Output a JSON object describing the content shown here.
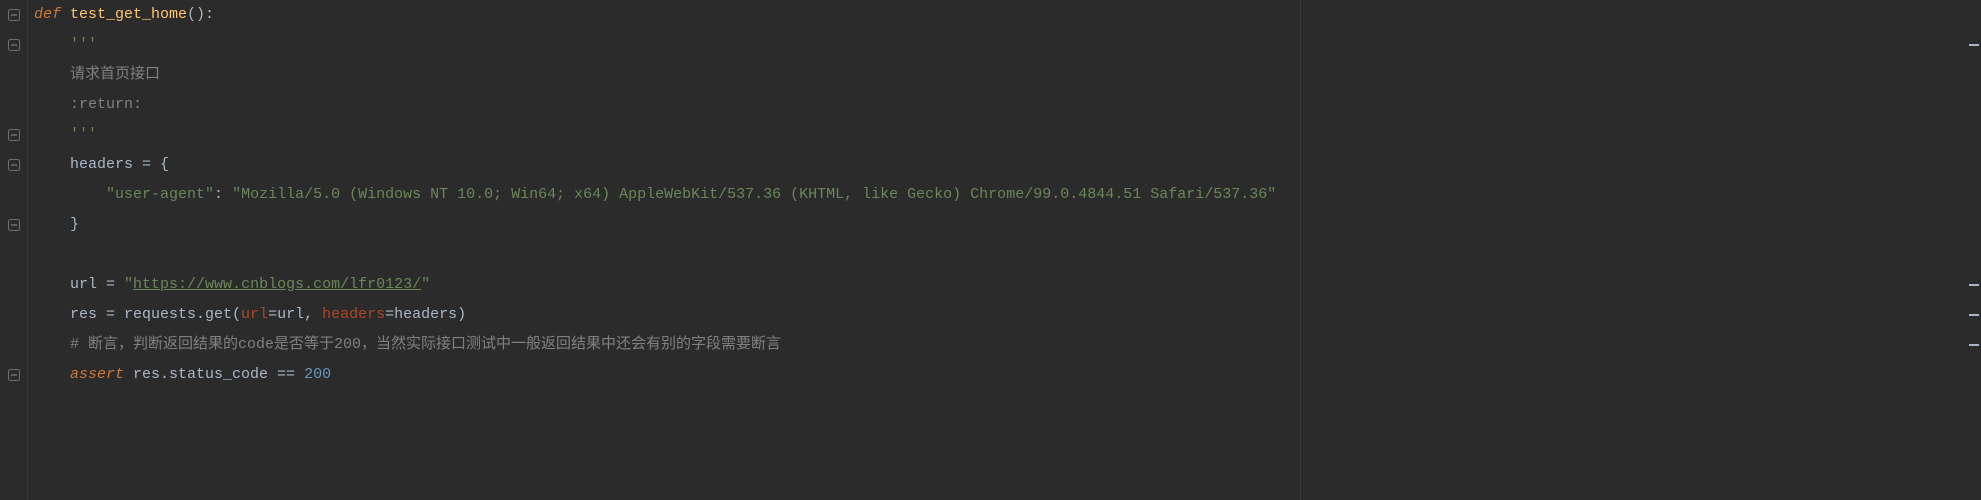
{
  "code": {
    "lines": [
      {
        "indent": 0,
        "tokens": [
          {
            "t": "def ",
            "c": "kw"
          },
          {
            "t": "test_get_home",
            "c": "fn"
          },
          {
            "t": "():",
            "c": "op"
          }
        ]
      },
      {
        "indent": 1,
        "tokens": [
          {
            "t": "'''",
            "c": "str"
          }
        ]
      },
      {
        "indent": 1,
        "tokens": [
          {
            "t": "请求首页接口",
            "c": "comment"
          }
        ]
      },
      {
        "indent": 1,
        "tokens": [
          {
            "t": ":return:",
            "c": "comment"
          }
        ]
      },
      {
        "indent": 1,
        "tokens": [
          {
            "t": "'''",
            "c": "str"
          }
        ]
      },
      {
        "indent": 1,
        "tokens": [
          {
            "t": "headers = {",
            "c": "ident"
          }
        ]
      },
      {
        "indent": 2,
        "tokens": [
          {
            "t": "\"user-agent\"",
            "c": "str"
          },
          {
            "t": ": ",
            "c": "op"
          },
          {
            "t": "\"Mozilla/5.0 (Windows NT 10.0; Win64; x64) AppleWebKit/537.36 (KHTML, like Gecko) Chrome/99.0.4844.51 Safari/537.36\"",
            "c": "str"
          }
        ]
      },
      {
        "indent": 1,
        "tokens": [
          {
            "t": "}",
            "c": "ident"
          }
        ]
      },
      {
        "indent": 0,
        "tokens": [
          {
            "t": "",
            "c": "ident"
          }
        ]
      },
      {
        "indent": 1,
        "tokens": [
          {
            "t": "url = ",
            "c": "ident"
          },
          {
            "t": "\"",
            "c": "str"
          },
          {
            "t": "https://www.cnblogs.com/lfr0123/",
            "c": "str underline"
          },
          {
            "t": "\"",
            "c": "str"
          }
        ]
      },
      {
        "indent": 1,
        "tokens": [
          {
            "t": "res = requests.get(",
            "c": "ident"
          },
          {
            "t": "url",
            "c": "param"
          },
          {
            "t": "=url",
            "c": "ident"
          },
          {
            "t": ", ",
            "c": "op"
          },
          {
            "t": "headers",
            "c": "param"
          },
          {
            "t": "=headers)",
            "c": "ident"
          }
        ]
      },
      {
        "indent": 1,
        "tokens": [
          {
            "t": "# 断言，判断返回结果的code是否等于200，当然实际接口测试中一般返回结果中还会有别的字段需要断言",
            "c": "comment"
          }
        ]
      },
      {
        "indent": 1,
        "tokens": [
          {
            "t": "assert ",
            "c": "kw"
          },
          {
            "t": "res.status_code == ",
            "c": "ident"
          },
          {
            "t": "200",
            "c": "num"
          }
        ]
      }
    ]
  },
  "gutter": {
    "fold_positions": [
      0,
      1,
      4,
      5,
      7,
      12
    ],
    "open_positions": []
  },
  "marks": [
    1,
    9,
    10,
    11
  ]
}
